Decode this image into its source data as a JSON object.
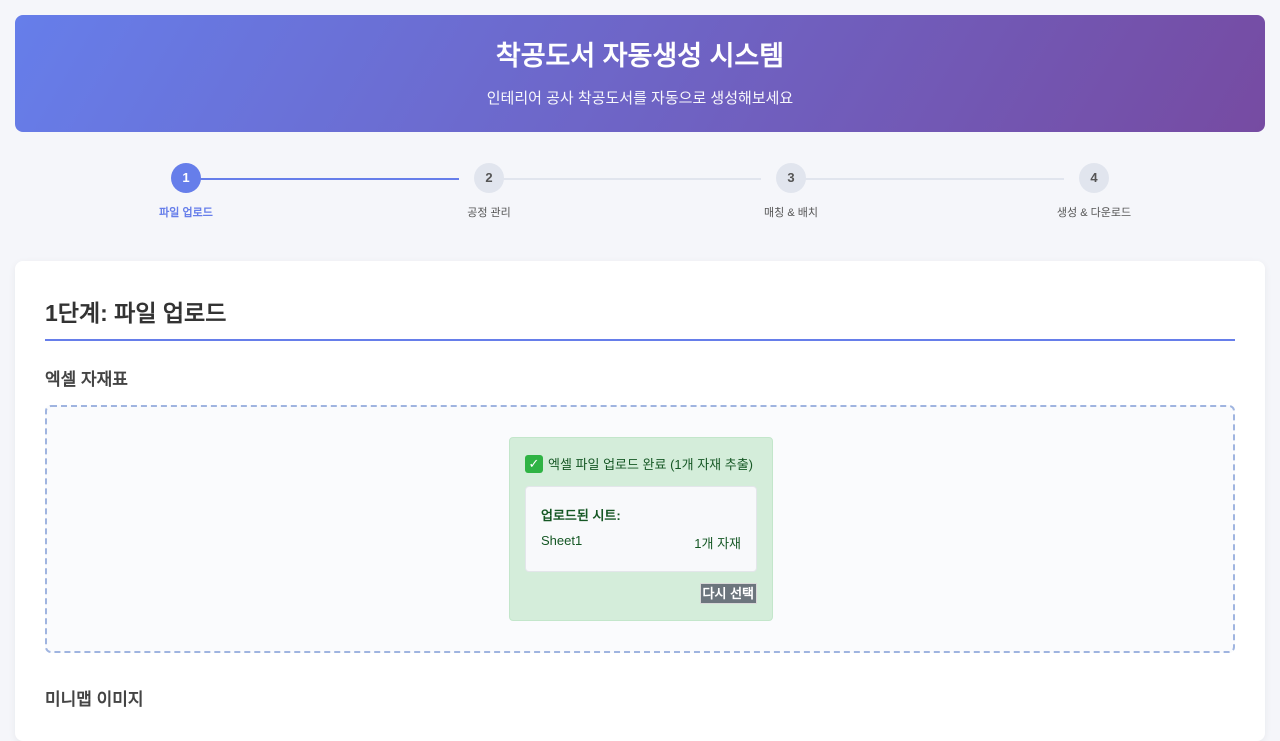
{
  "header": {
    "title": "착공도서 자동생성 시스템",
    "subtitle": "인테리어 공사 착공도서를 자동으로 생성해보세요"
  },
  "steps": [
    {
      "number": "1",
      "label": "파일 업로드",
      "active": true
    },
    {
      "number": "2",
      "label": "공정 관리",
      "active": false
    },
    {
      "number": "3",
      "label": "매칭 & 배치",
      "active": false
    },
    {
      "number": "4",
      "label": "생성 & 다운로드",
      "active": false
    }
  ],
  "main": {
    "heading": "1단계: 파일 업로드",
    "excel_section_title": "엑셀 자재표",
    "upload_status": "엑셀 파일 업로드 완료 (1개 자재 추출)",
    "uploaded_sheets_title": "업로드된 시트:",
    "sheets": [
      {
        "name": "Sheet1",
        "count": "1개 자재"
      }
    ],
    "reselect_label": "다시 선택",
    "minimap_section_title": "미니맵 이미지"
  },
  "colors": {
    "accent": "#667eea",
    "gradient_end": "#764ba2",
    "success_bg": "#d4edda",
    "success_text": "#155724"
  }
}
